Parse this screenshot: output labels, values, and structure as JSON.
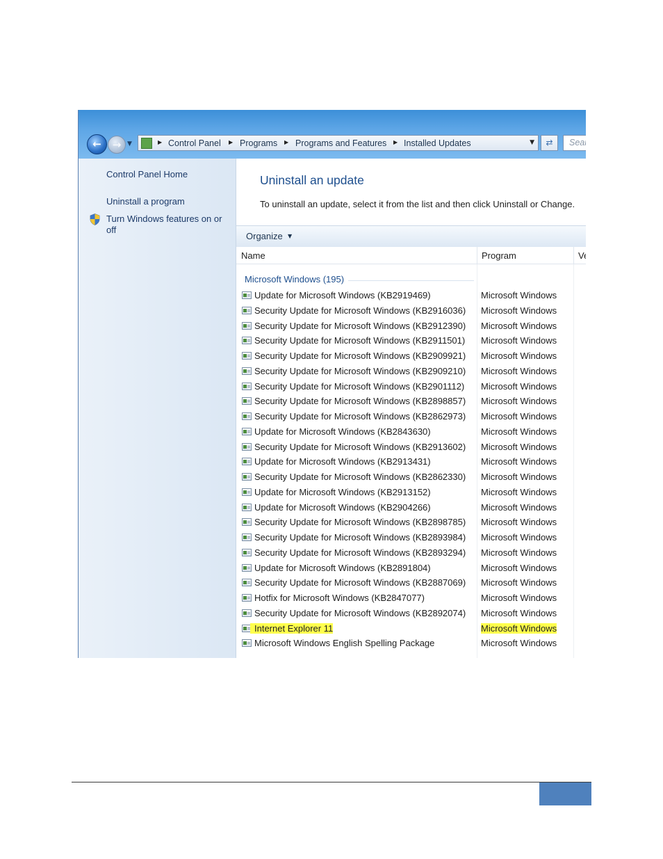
{
  "address_bar": {
    "crumbs": [
      "Control Panel",
      "Programs",
      "Programs and Features",
      "Installed Updates"
    ],
    "search_placeholder": "Sear"
  },
  "left_pane": {
    "links": [
      "Control Panel Home",
      "Uninstall a program"
    ],
    "features_link_line1": "Turn Windows features on or",
    "features_link_line2": "off"
  },
  "main": {
    "title": "Uninstall an update",
    "description": "To uninstall an update, select it from the list and then click Uninstall or Change.",
    "organize_label": "Organize",
    "columns": {
      "name": "Name",
      "program": "Program",
      "version": "Ve"
    },
    "group_label": "Microsoft Windows (195)",
    "rows": [
      {
        "name": "Update for Microsoft Windows (KB2919469)",
        "program": "Microsoft Windows"
      },
      {
        "name": "Security Update for Microsoft Windows (KB2916036)",
        "program": "Microsoft Windows"
      },
      {
        "name": "Security Update for Microsoft Windows (KB2912390)",
        "program": "Microsoft Windows"
      },
      {
        "name": "Security Update for Microsoft Windows (KB2911501)",
        "program": "Microsoft Windows"
      },
      {
        "name": "Security Update for Microsoft Windows (KB2909921)",
        "program": "Microsoft Windows"
      },
      {
        "name": "Security Update for Microsoft Windows (KB2909210)",
        "program": "Microsoft Windows"
      },
      {
        "name": "Security Update for Microsoft Windows (KB2901112)",
        "program": "Microsoft Windows"
      },
      {
        "name": "Security Update for Microsoft Windows (KB2898857)",
        "program": "Microsoft Windows"
      },
      {
        "name": "Security Update for Microsoft Windows (KB2862973)",
        "program": "Microsoft Windows"
      },
      {
        "name": "Update for Microsoft Windows (KB2843630)",
        "program": "Microsoft Windows"
      },
      {
        "name": "Security Update for Microsoft Windows (KB2913602)",
        "program": "Microsoft Windows"
      },
      {
        "name": "Update for Microsoft Windows (KB2913431)",
        "program": "Microsoft Windows"
      },
      {
        "name": "Security Update for Microsoft Windows (KB2862330)",
        "program": "Microsoft Windows"
      },
      {
        "name": "Update for Microsoft Windows (KB2913152)",
        "program": "Microsoft Windows"
      },
      {
        "name": "Update for Microsoft Windows (KB2904266)",
        "program": "Microsoft Windows"
      },
      {
        "name": "Security Update for Microsoft Windows (KB2898785)",
        "program": "Microsoft Windows"
      },
      {
        "name": "Security Update for Microsoft Windows (KB2893984)",
        "program": "Microsoft Windows"
      },
      {
        "name": "Security Update for Microsoft Windows (KB2893294)",
        "program": "Microsoft Windows"
      },
      {
        "name": "Update for Microsoft Windows (KB2891804)",
        "program": "Microsoft Windows"
      },
      {
        "name": "Security Update for Microsoft Windows (KB2887069)",
        "program": "Microsoft Windows"
      },
      {
        "name": "Hotfix for Microsoft Windows (KB2847077)",
        "program": "Microsoft Windows"
      },
      {
        "name": "Security Update for Microsoft Windows (KB2892074)",
        "program": "Microsoft Windows"
      },
      {
        "name": "Internet Explorer 11",
        "program": "Microsoft Windows",
        "highlighted": true
      },
      {
        "name": "Microsoft Windows English Spelling Package",
        "program": "Microsoft Windows"
      }
    ]
  },
  "colors": {
    "highlight": "#ffff4d",
    "link": "#1c3a68",
    "title": "#1e4f8e",
    "footer_accent": "#4f81bd"
  },
  "icons": {
    "back": "back-arrow-icon",
    "forward": "forward-arrow-icon",
    "folder": "control-panel-icon",
    "refresh": "refresh-icon",
    "shield": "uac-shield-icon",
    "row": "update-icon"
  }
}
